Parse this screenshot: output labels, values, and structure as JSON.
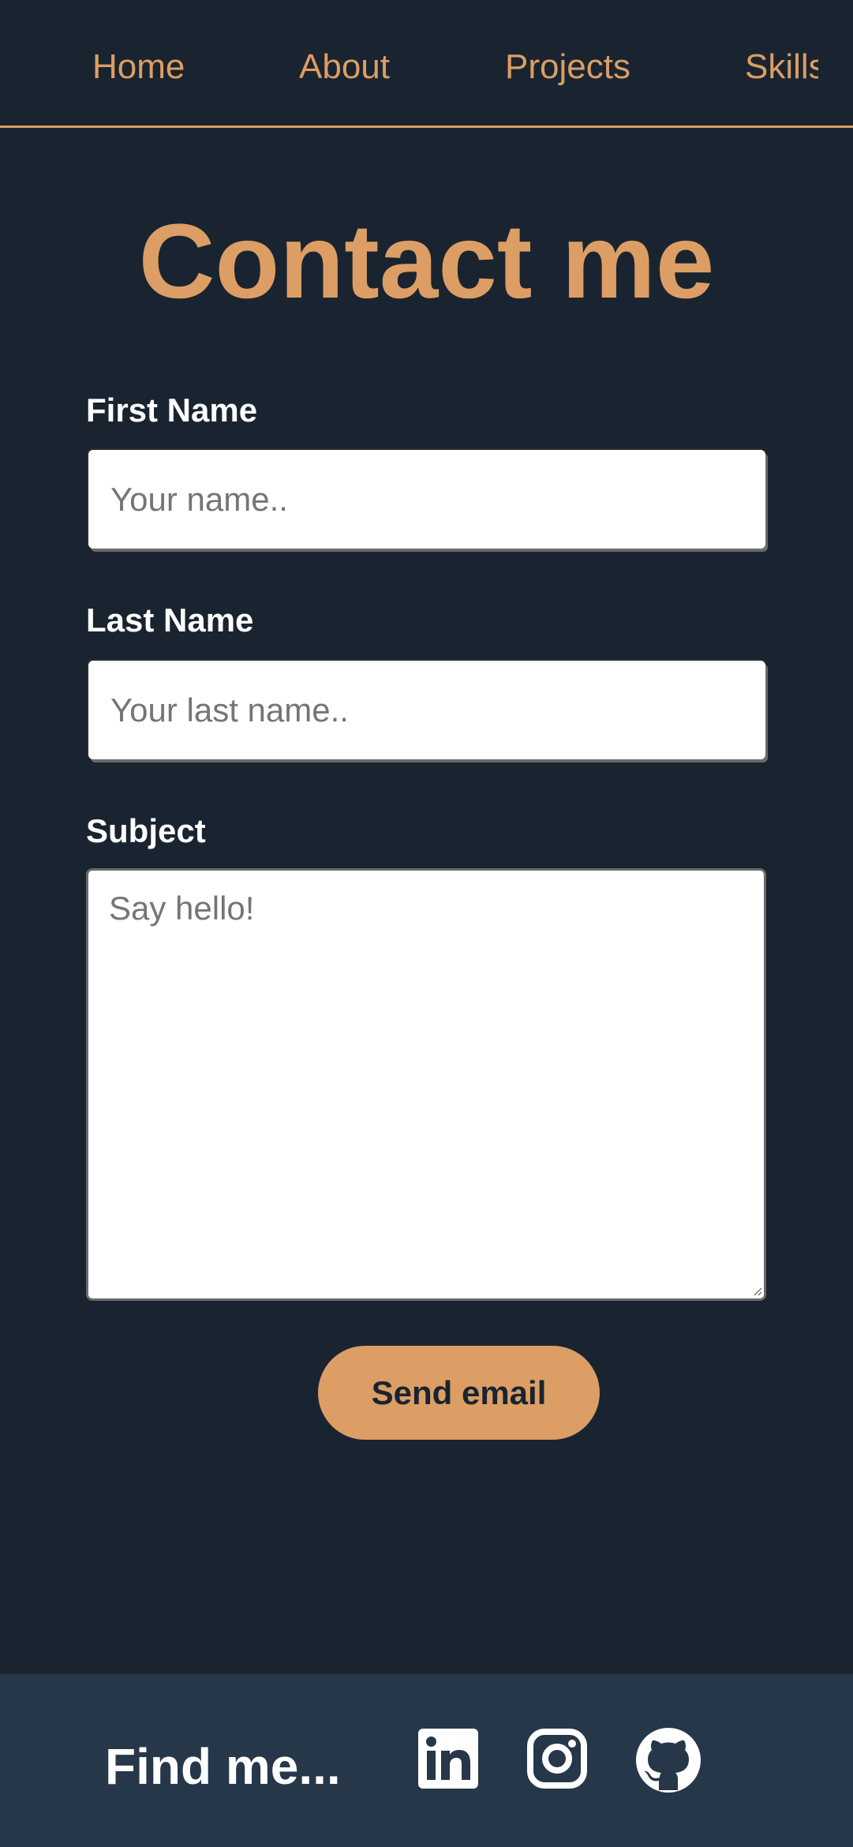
{
  "nav": {
    "items": [
      {
        "label": "Home"
      },
      {
        "label": "About"
      },
      {
        "label": "Projects"
      },
      {
        "label": "Skills"
      }
    ]
  },
  "page": {
    "title": "Contact me"
  },
  "form": {
    "first_name": {
      "label": "First Name",
      "placeholder": "Your name.."
    },
    "last_name": {
      "label": "Last Name",
      "placeholder": "Your last name.."
    },
    "subject": {
      "label": "Subject",
      "placeholder": "Say hello!"
    },
    "submit_label": "Send email"
  },
  "footer": {
    "text": "Find me...",
    "icons": [
      "linkedin-icon",
      "instagram-icon",
      "github-icon"
    ]
  },
  "colors": {
    "background": "#1a2430",
    "accent": "#dc9e65",
    "footer_background": "#263749",
    "text": "#ffffff"
  }
}
